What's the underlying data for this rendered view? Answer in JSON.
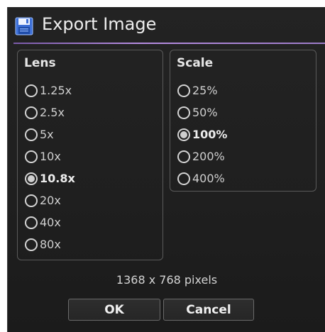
{
  "window": {
    "title": "Export Image",
    "icon": "save-disk-icon",
    "accent_color": "#9c7bc8"
  },
  "lens": {
    "title": "Lens",
    "options": [
      "1.25x",
      "2.5x",
      "5x",
      "10x",
      "10.8x",
      "20x",
      "40x",
      "80x"
    ],
    "selected": "10.8x"
  },
  "scale": {
    "title": "Scale",
    "options": [
      "25%",
      "50%",
      "100%",
      "200%",
      "400%"
    ],
    "selected": "100%"
  },
  "info": {
    "dimensions": "1368 x 768 pixels"
  },
  "buttons": {
    "ok_label": "OK",
    "cancel_label": "Cancel"
  }
}
